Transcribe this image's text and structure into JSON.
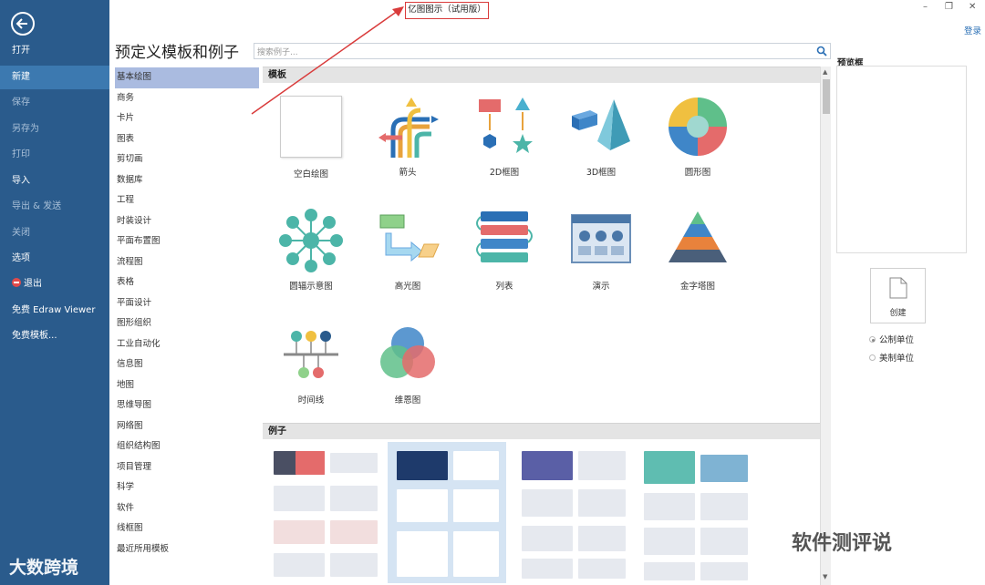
{
  "window": {
    "title": "亿图图示（试用版）",
    "login": "登录"
  },
  "nav": {
    "items": [
      {
        "label": "打开",
        "state": "normal"
      },
      {
        "label": "新建",
        "state": "active"
      },
      {
        "label": "保存",
        "state": "dim"
      },
      {
        "label": "另存为",
        "state": "dim"
      },
      {
        "label": "打印",
        "state": "dim"
      },
      {
        "label": "导入",
        "state": "normal"
      },
      {
        "label": "导出 & 发送",
        "state": "dim"
      },
      {
        "label": "关闭",
        "state": "dim"
      },
      {
        "label": "选项",
        "state": "normal"
      },
      {
        "label": "退出",
        "state": "normal"
      },
      {
        "label": "免费 Edraw Viewer",
        "state": "normal"
      },
      {
        "label": "免费模板...",
        "state": "normal"
      }
    ]
  },
  "page": {
    "heading": "预定义模板和例子",
    "search_placeholder": "搜索例子..."
  },
  "categories": [
    "基本绘图",
    "商务",
    "卡片",
    "图表",
    "剪切画",
    "数据库",
    "工程",
    "时装设计",
    "平面布置图",
    "流程图",
    "表格",
    "平面设计",
    "图形组织",
    "工业自动化",
    "信息图",
    "地图",
    "思维导图",
    "网络图",
    "组织结构图",
    "项目管理",
    "科学",
    "软件",
    "线框图",
    "最近所用模板"
  ],
  "active_category": "基本绘图",
  "sections": {
    "templates": "模板",
    "examples": "例子"
  },
  "templates": [
    {
      "label": "空白绘图",
      "icon": "blank-page-icon"
    },
    {
      "label": "箭头",
      "icon": "arrows-icon"
    },
    {
      "label": "2D框图",
      "icon": "2d-shapes-icon"
    },
    {
      "label": "3D框图",
      "icon": "3d-shapes-icon"
    },
    {
      "label": "圆形图",
      "icon": "circle-diagram-icon"
    },
    {
      "label": "圆辐示意图",
      "icon": "radial-diagram-icon"
    },
    {
      "label": "高光图",
      "icon": "highlight-diagram-icon"
    },
    {
      "label": "列表",
      "icon": "list-icon"
    },
    {
      "label": "演示",
      "icon": "presentation-icon"
    },
    {
      "label": "金字塔图",
      "icon": "pyramid-icon"
    },
    {
      "label": "时间线",
      "icon": "timeline-icon"
    },
    {
      "label": "维恩图",
      "icon": "venn-icon"
    }
  ],
  "preview": {
    "label": "预览框",
    "create": "创建"
  },
  "units": [
    {
      "label": "公制单位",
      "selected": true
    },
    {
      "label": "美制单位",
      "selected": false
    }
  ],
  "watermarks": {
    "left": "大数跨境",
    "right": "软件测评说"
  },
  "colors": {
    "nav_bg": "#2a5b8c",
    "nav_active": "#3c79b0",
    "category_active": "#aabbe0",
    "title_box_border": "#d93b3b"
  }
}
